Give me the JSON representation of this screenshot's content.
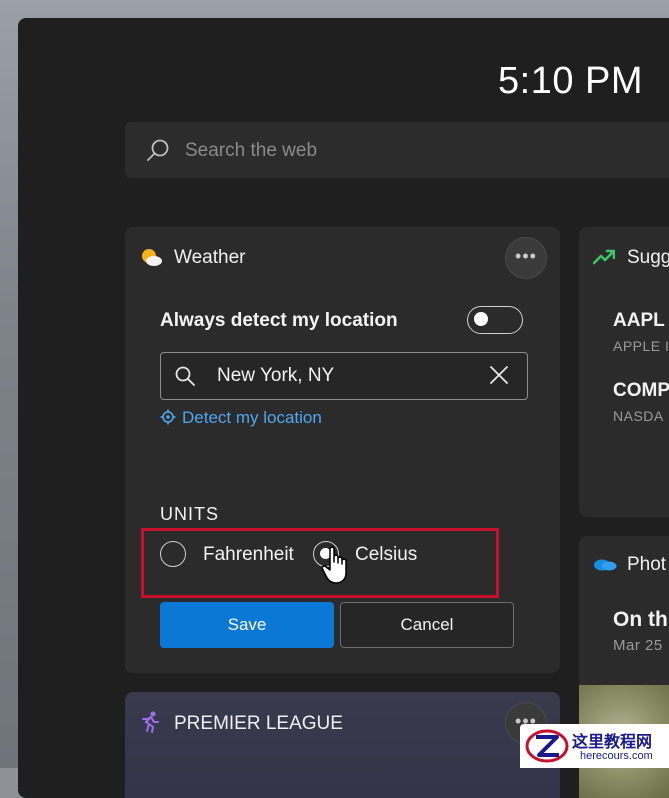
{
  "taskbar": {
    "time": "5:10 PM"
  },
  "search": {
    "placeholder": "Search the web"
  },
  "weather_card": {
    "title": "Weather",
    "more_label": "•••",
    "toggle_label": "Always detect my location",
    "toggle_state": "off",
    "location_value": "New York, NY",
    "detect_link": "Detect my location",
    "units_label": "UNITS",
    "units_options": [
      "Fahrenheit",
      "Celsius"
    ],
    "units_selected": "Celsius",
    "save_label": "Save",
    "cancel_label": "Cancel"
  },
  "premier_card": {
    "title": "PREMIER LEAGUE",
    "more_label": "•••"
  },
  "suggested_card": {
    "title": "Sugg",
    "stocks": [
      {
        "symbol": "AAPL",
        "name": "APPLE I"
      },
      {
        "symbol": "COMP",
        "name": "NASDA"
      }
    ]
  },
  "photos_card": {
    "title": "Phot",
    "headline": "On th",
    "date": "Mar 25"
  },
  "watermark": {
    "cn_text": "这里教程网",
    "en_text": "herecours.com"
  },
  "colors": {
    "accent": "#0a78d4",
    "link": "#4ea6f0",
    "highlight_box": "#c8102e",
    "panel": "#1f1f1f",
    "card": "#2b2b2b"
  }
}
